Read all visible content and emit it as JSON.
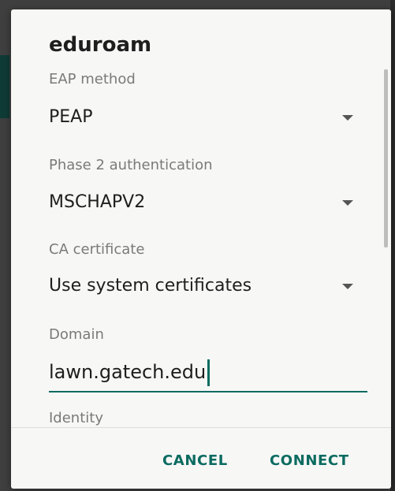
{
  "dialog": {
    "title": "eduroam",
    "fields": {
      "eap_method": {
        "label": "EAP method",
        "value": "PEAP"
      },
      "phase2": {
        "label": "Phase 2 authentication",
        "value": "MSCHAPV2"
      },
      "ca_certificate": {
        "label": "CA certificate",
        "value": "Use system certificates"
      },
      "domain": {
        "label": "Domain",
        "value": "lawn.gatech.edu"
      },
      "identity": {
        "label": "Identity"
      }
    },
    "buttons": {
      "cancel": "CANCEL",
      "connect": "CONNECT"
    }
  },
  "colors": {
    "accent": "#0b6b60",
    "dialog_bg": "#f7f7f6",
    "label": "#7a7a7a",
    "value": "#1e1e1e"
  },
  "icons": {
    "dropdown": "caret-down-icon"
  }
}
